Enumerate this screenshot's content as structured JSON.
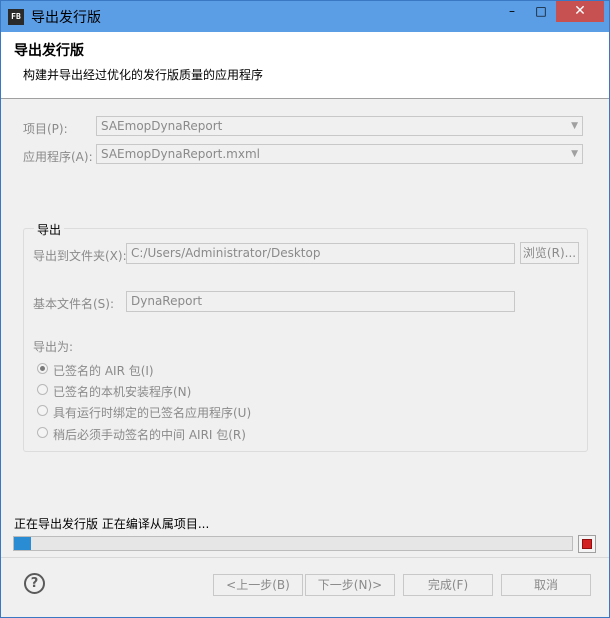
{
  "window": {
    "title": "导出发行版",
    "icon_text": "FB",
    "controls": {
      "min": "–",
      "max": "□",
      "close": "✕"
    }
  },
  "banner": {
    "title": "导出发行版",
    "description": "构建并导出经过优化的发行版质量的应用程序"
  },
  "project": {
    "label": "项目(P):",
    "value": "SAEmopDynaReport"
  },
  "application": {
    "label": "应用程序(A):",
    "value": "SAEmopDynaReport.mxml"
  },
  "export_group": {
    "title": "导出",
    "folder_label": "导出到文件夹(X):",
    "folder_value": "C:/Users/Administrator/Desktop",
    "browse_label": "浏览(R)...",
    "basename_label": "基本文件名(S):",
    "basename_value": "DynaReport",
    "export_as_label": "导出为:",
    "options": [
      {
        "label": "已签名的 AIR 包(I)",
        "checked": true
      },
      {
        "label": "已签名的本机安装程序(N)",
        "checked": false
      },
      {
        "label": "具有运行时绑定的已签名应用程序(U)",
        "checked": false
      },
      {
        "label": "稍后必须手动签名的中间 AIRI 包(R)",
        "checked": false
      }
    ]
  },
  "progress": {
    "status": "正在导出发行版 正在编译从属项目...",
    "fraction": 0.03
  },
  "footer": {
    "back": "<上一步(B)",
    "next": "下一步(N)>",
    "finish": "完成(F)",
    "cancel": "取消",
    "help": "?"
  },
  "colors": {
    "titlebar": "#5c9ee6",
    "close": "#c75050",
    "progress": "#2a8dd4"
  }
}
